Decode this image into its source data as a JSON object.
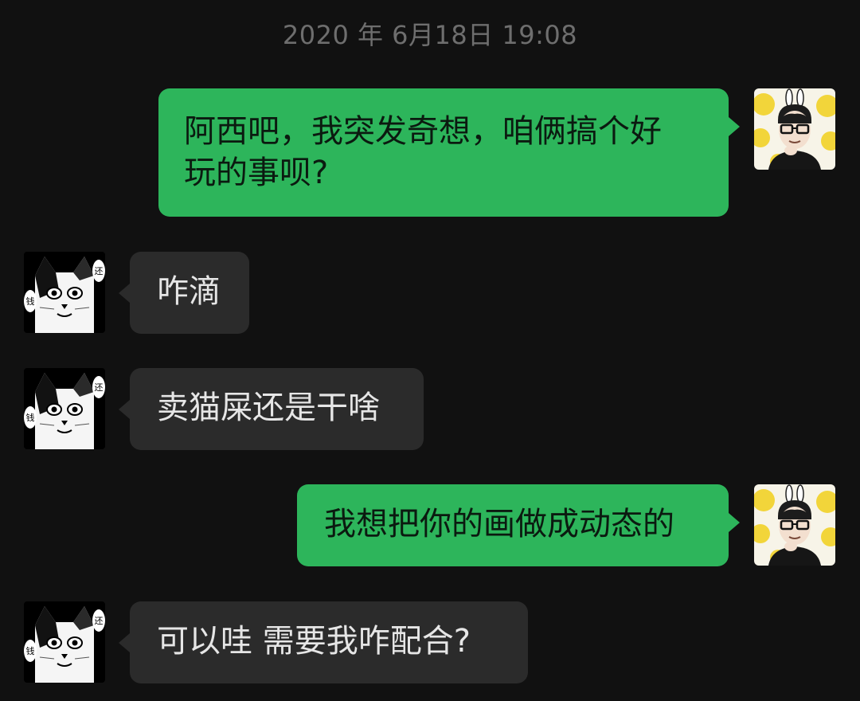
{
  "chat": {
    "timestamp": "2020 年 6月18日 19:08",
    "messages": [
      {
        "from": "me",
        "text": "阿西吧，我突发奇想，咱俩搞个好\n玩的事呗?"
      },
      {
        "from": "other",
        "text": "咋滴"
      },
      {
        "from": "other",
        "text": "卖猫屎还是干啥"
      },
      {
        "from": "me",
        "text": "我想把你的画做成动态的"
      },
      {
        "from": "other",
        "text": "可以哇 需要我咋配合?"
      }
    ]
  },
  "avatars": {
    "me": {
      "icon": "man-glasses-bunny-ears-avatar",
      "bg": "#f7f4e8",
      "accent": "#f2d53a"
    },
    "other": {
      "icon": "bw-cat-avatar",
      "bg": "#000000",
      "labels": [
        "还",
        "钱"
      ]
    }
  },
  "colors": {
    "background": "#111111",
    "my_bubble": "#2db55b",
    "other_bubble": "#2b2b2b",
    "timestamp": "#6e6e6e"
  }
}
